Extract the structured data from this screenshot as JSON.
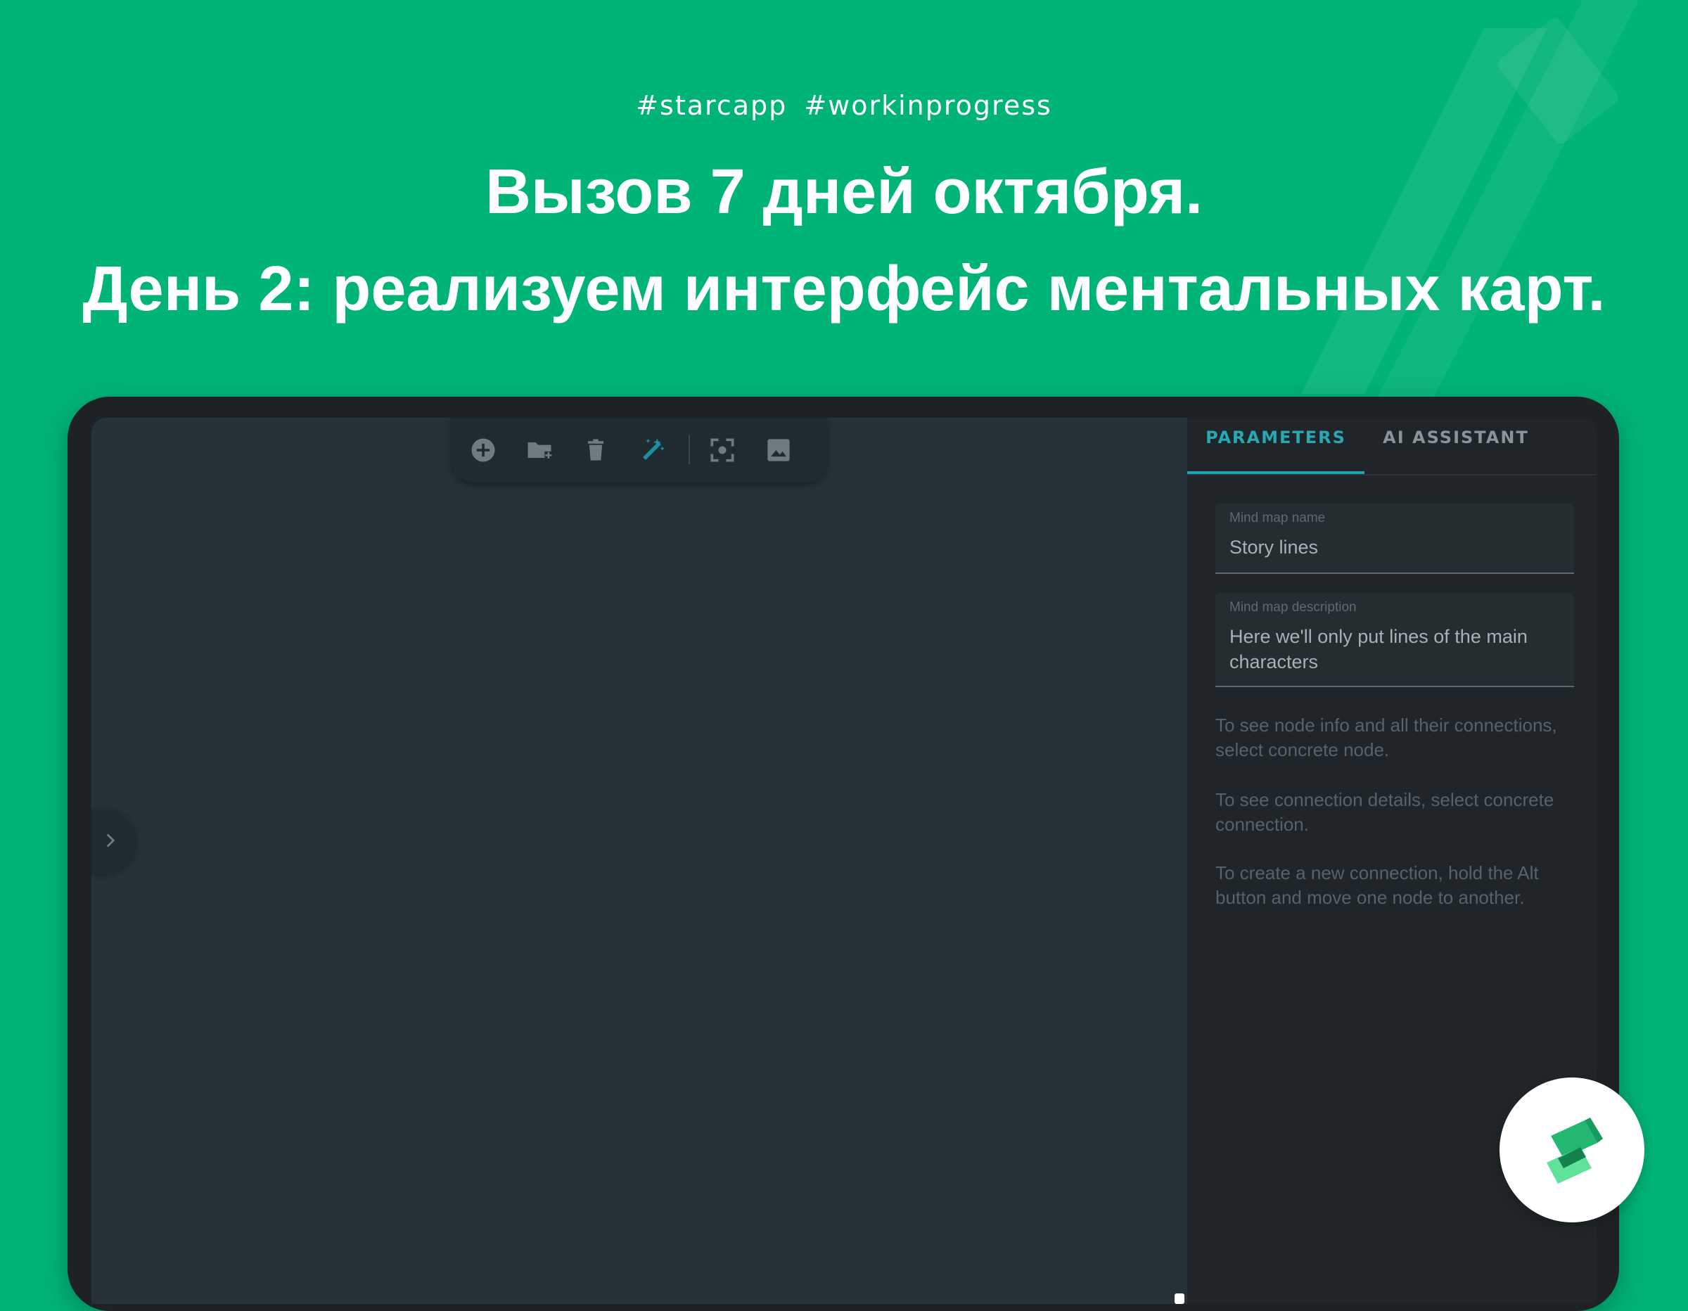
{
  "banner": {
    "hashtags": "#starcapp  #workinprogress",
    "headline_line1": "Вызов 7 дней октября.",
    "headline_line2": "День 2: реализуем интерфейс ментальных карт."
  },
  "colors": {
    "background": "#00b377",
    "canvas": "#263238",
    "panel": "#1f2528",
    "accent": "#26a9b5",
    "icon_gray": "#6f7b80"
  },
  "toolbar": {
    "icons": [
      "add-circle-icon",
      "new-folder-icon",
      "trash-icon",
      "magic-wand-icon",
      "fit-view-icon",
      "image-export-icon"
    ]
  },
  "side_toggle": {
    "icon": "chevron-right-icon"
  },
  "panel": {
    "tabs": [
      {
        "label": "PARAMETERS",
        "active": true
      },
      {
        "label": "AI ASSISTANT",
        "active": false
      }
    ],
    "name_field": {
      "label": "Mind map name",
      "value": "Story lines"
    },
    "description_field": {
      "label": "Mind map description",
      "value": "Here we'll only put lines of the main characters"
    },
    "hints": [
      "To see node info and all their connections, select concrete node.",
      "To see connection details, select concrete connection.",
      "To create a new connection, hold the Alt button and move one node to another."
    ]
  },
  "logo": {
    "icon": "starcapp-logo-icon"
  }
}
